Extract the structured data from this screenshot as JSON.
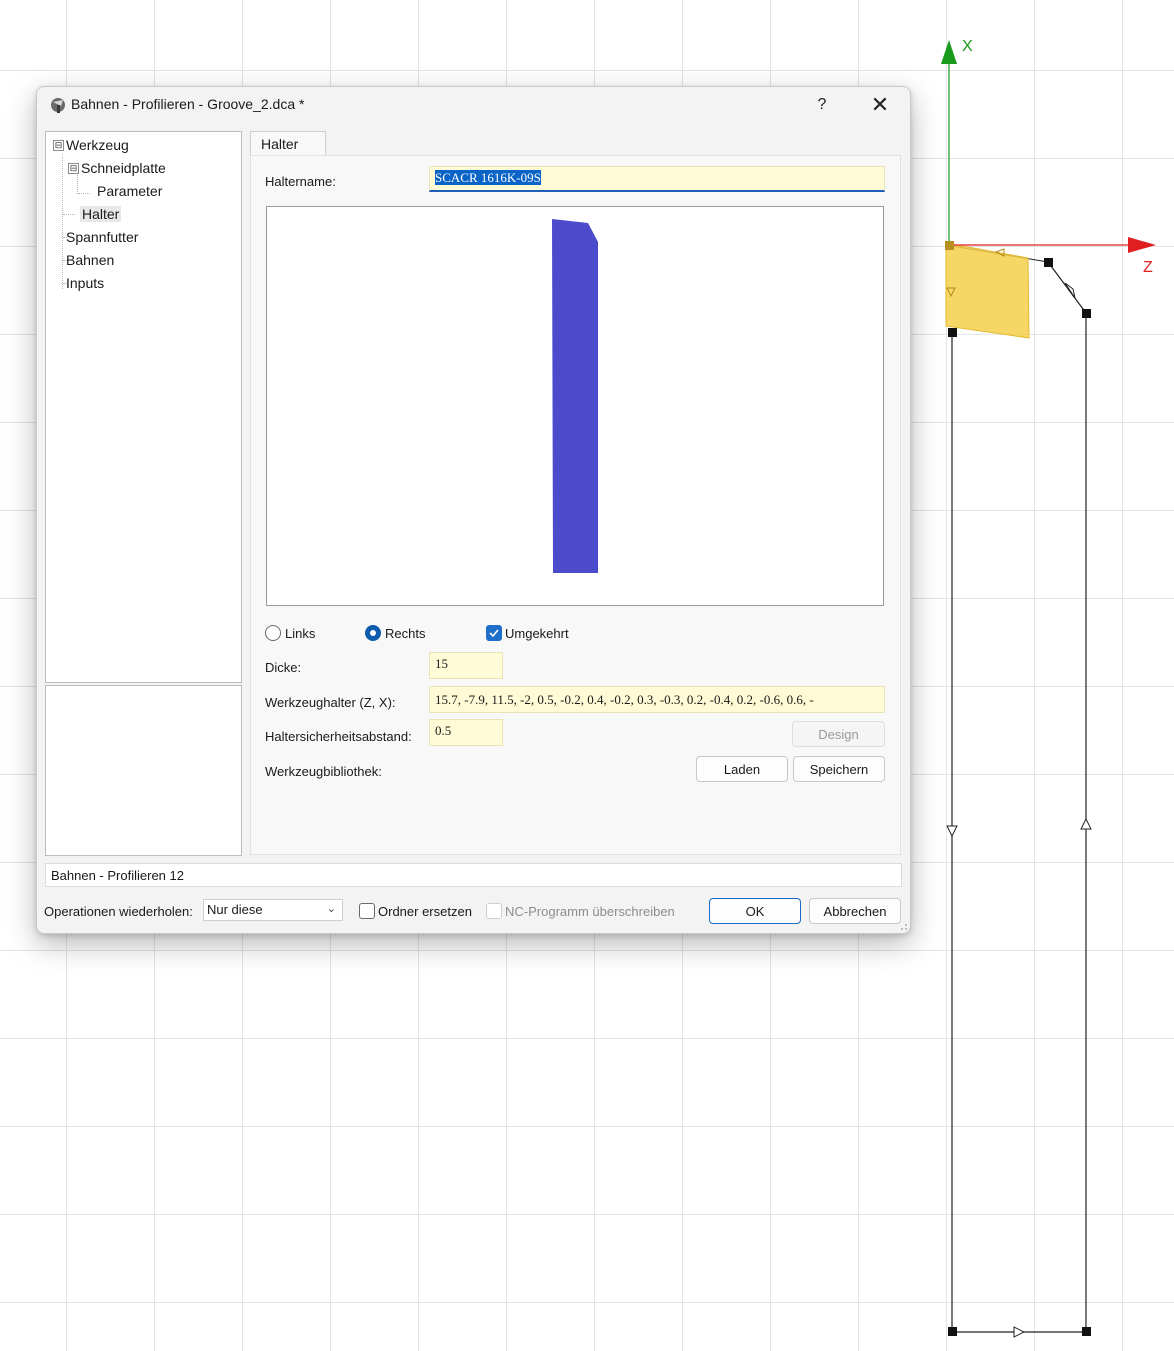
{
  "dialog": {
    "title": "Bahnen - Profilieren - Groove_2.dca *",
    "help_label": "?",
    "close_label": "✕"
  },
  "tree": {
    "items": [
      {
        "label": "Werkzeug",
        "expander": "⊟"
      },
      {
        "label": "Schneidplatte",
        "expander": "⊟"
      },
      {
        "label": "Parameter"
      },
      {
        "label": "Halter",
        "selected": true
      },
      {
        "label": "Spannfutter"
      },
      {
        "label": "Bahnen"
      },
      {
        "label": "Inputs"
      }
    ]
  },
  "tab": {
    "label": "Halter"
  },
  "form": {
    "haltername_label": "Haltername:",
    "haltername_value": "SCACR 1616K-09S",
    "side_left_label": "Links",
    "side_right_label": "Rechts",
    "side_selected": "Rechts",
    "reversed_label": "Umgekehrt",
    "reversed_checked": true,
    "dicke_label": "Dicke:",
    "dicke_value": "15",
    "werkzeughalter_label": "Werkzeughalter (Z, X):",
    "werkzeughalter_value": "15.7, -7.9, 11.5, -2, 0.5, -0.2, 0.4, -0.2, 0.3, -0.3, 0.2, -0.4, 0.2, -0.6, 0.6, -",
    "sicherheit_label": "Haltersicherheitsabstand:",
    "sicherheit_value": "0.5",
    "design_label": "Design",
    "bibliothek_label": "Werkzeugbibliothek:",
    "laden_label": "Laden",
    "speichern_label": "Speichern"
  },
  "preview": {
    "holder_color": "#4b4bcc"
  },
  "status": {
    "text": "Bahnen - Profilieren 12"
  },
  "bottom": {
    "repeat_label": "Operationen wiederholen:",
    "repeat_value": "Nur diese",
    "replace_folder_label": "Ordner ersetzen",
    "replace_folder_checked": false,
    "overwrite_nc_label": "NC-Programm überschreiben",
    "overwrite_nc_enabled": false,
    "ok_label": "OK",
    "cancel_label": "Abbrechen"
  },
  "cad": {
    "axis_x_label": "X",
    "axis_z_label": "Z",
    "axis_x_color": "#1a9a1a",
    "axis_z_color": "#e02020",
    "insert_color": "#f5d04a"
  }
}
